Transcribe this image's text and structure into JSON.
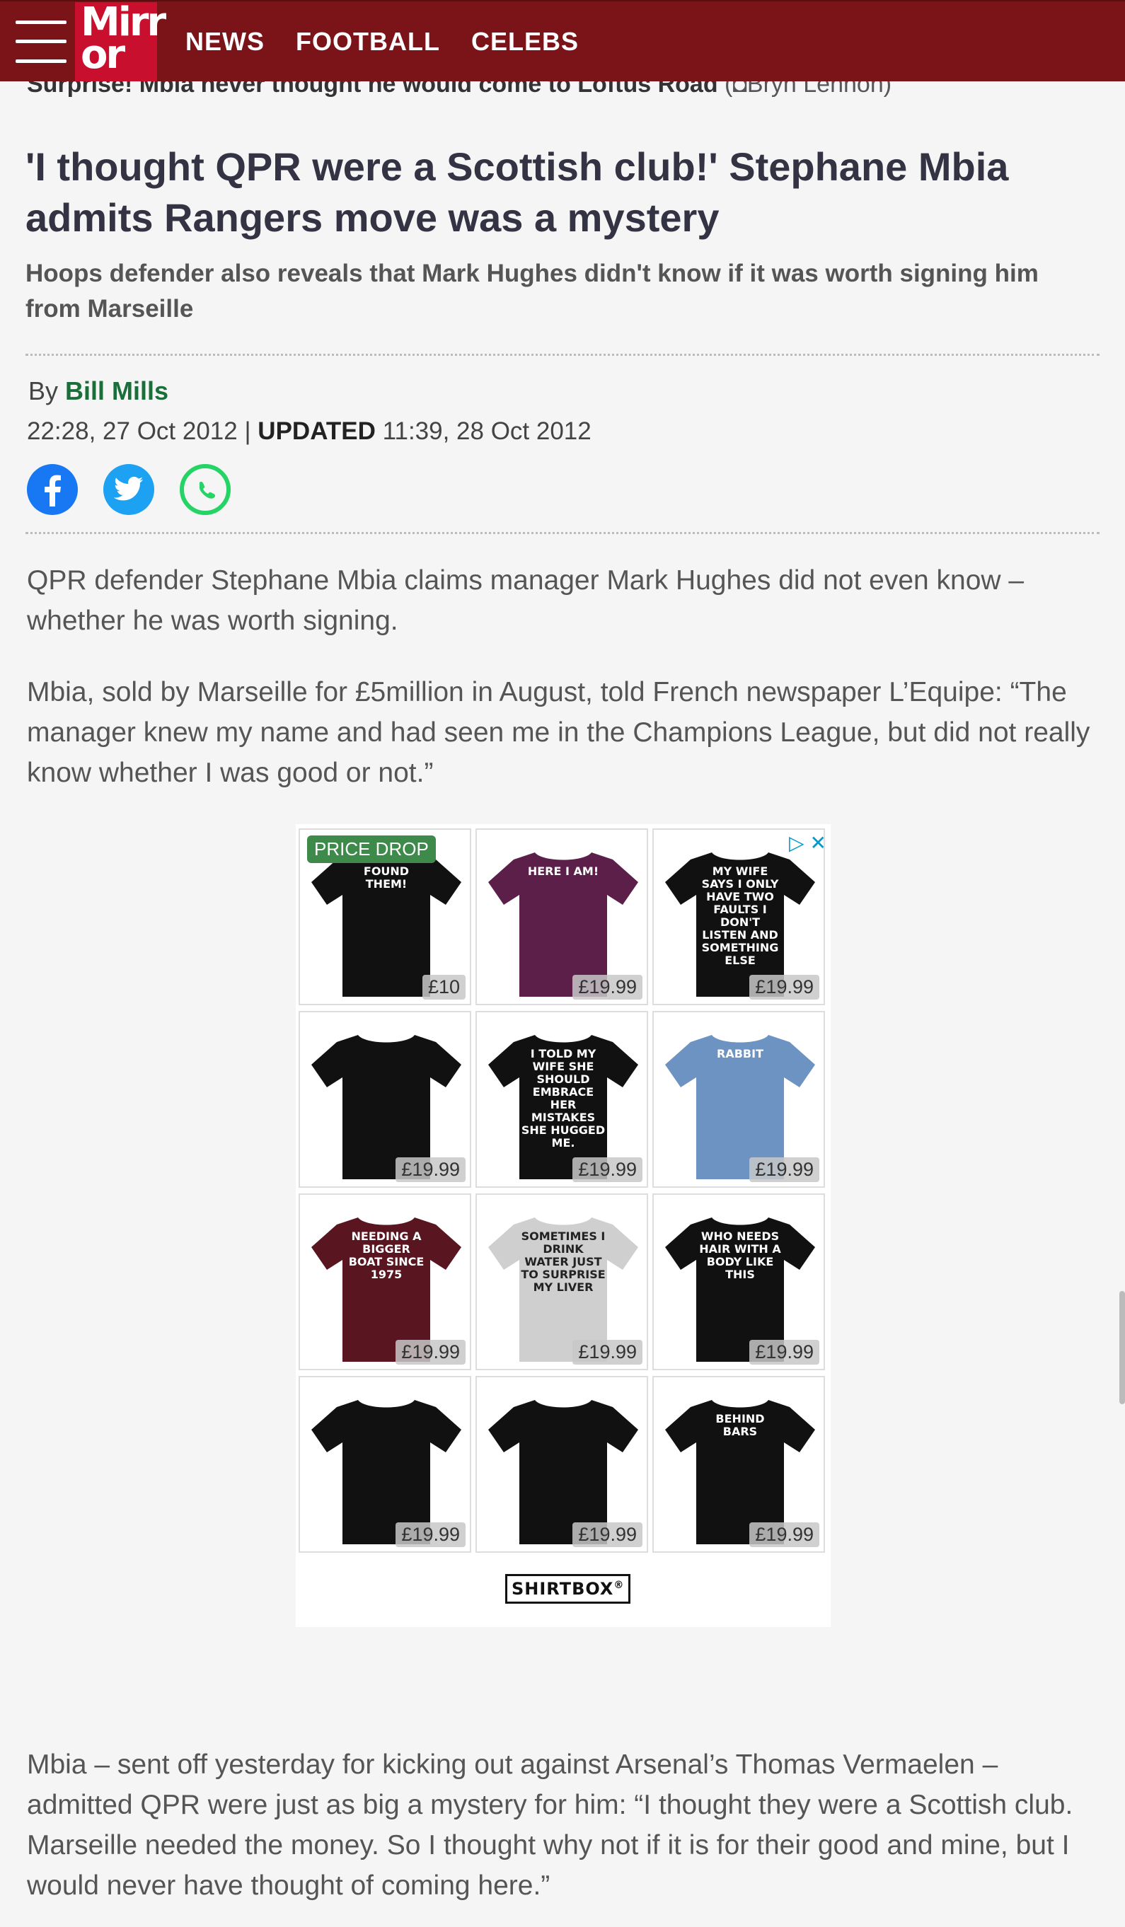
{
  "header": {
    "logo": "Mirr or",
    "nav": [
      "NEWS",
      "FOOTBALL",
      "CELEBS"
    ]
  },
  "caption": {
    "text": "Surprise! Mbia never thought he would come to Loftus Road",
    "credit": "Bryn Lennon)"
  },
  "article": {
    "headline": "'I thought QPR were a Scottish club!' Stephane Mbia admits Rangers move was a mystery",
    "standfirst": "Hoops defender also reveals that Mark Hughes didn't know if it was worth signing him from Marseille",
    "byline_prefix": "By",
    "author": "Bill Mills",
    "published": "22:28, 27 Oct 2012",
    "separator": "|",
    "updated_label": "UPDATED",
    "updated": "11:39, 28 Oct 2012",
    "paragraphs": [
      "QPR defender Stephane Mbia claims manager Mark Hughes did not even know – whether he was worth signing.",
      "Mbia, sold by Marseille for £5million in August, told French newspaper L’Equipe: “The manager knew my name and had seen me in the Champions League, but did not really know whether I was good or not.”",
      "Mbia – sent off yesterday for kicking out against Arsenal’s Thomas Vermaelen – admitted QPR were just as big a mystery for him: “I thought they were a Scottish club. Marseille needed the money. So I thought why not if it is for their good and mine, but I would never have thought of coming here.”"
    ]
  },
  "share": {
    "icons": [
      "facebook-icon",
      "twitter-icon",
      "whatsapp-icon"
    ]
  },
  "ad": {
    "badge": "PRICE DROP",
    "adchoices_icon": "▷",
    "close_icon": "✕",
    "brand": "SHIRTBOX",
    "brand_mark": "®",
    "items": [
      {
        "color": "#111111",
        "text": "FOUND THEM!",
        "price": "£10"
      },
      {
        "color": "#5b1f4a",
        "text": "HERE I AM!",
        "price": "£19.99"
      },
      {
        "color": "#111111",
        "text": "MY WIFE SAYS I ONLY HAVE TWO FAULTS I DON'T LISTEN AND SOMETHING ELSE",
        "price": "£19.99"
      },
      {
        "color": "#111111",
        "text": "",
        "price": "£19.99"
      },
      {
        "color": "#111111",
        "text": "I TOLD MY WIFE SHE SHOULD EMBRACE HER MISTAKES SHE HUGGED ME.",
        "price": "£19.99"
      },
      {
        "color": "#6d93c2",
        "text": "RABBIT",
        "price": "£19.99"
      },
      {
        "color": "#5a1620",
        "text": "NEEDING A BIGGER BOAT SINCE 1975",
        "price": "£19.99"
      },
      {
        "color": "#cfcfcf",
        "text": "SOMETIMES I DRINK WATER JUST TO SURPRISE MY LIVER",
        "price": "£19.99"
      },
      {
        "color": "#111111",
        "text": "WHO NEEDS HAIR WITH A BODY LIKE THIS",
        "price": "£19.99"
      },
      {
        "color": "#111111",
        "text": "",
        "price": "£19.99"
      },
      {
        "color": "#111111",
        "text": "",
        "price": "£19.99"
      },
      {
        "color": "#111111",
        "text": "BEHIND BARS",
        "price": "£19.99"
      }
    ]
  },
  "colors": {
    "header_bg": "#7a1418",
    "logo_bg": "#c8102e",
    "author": "#1a6e3a"
  }
}
